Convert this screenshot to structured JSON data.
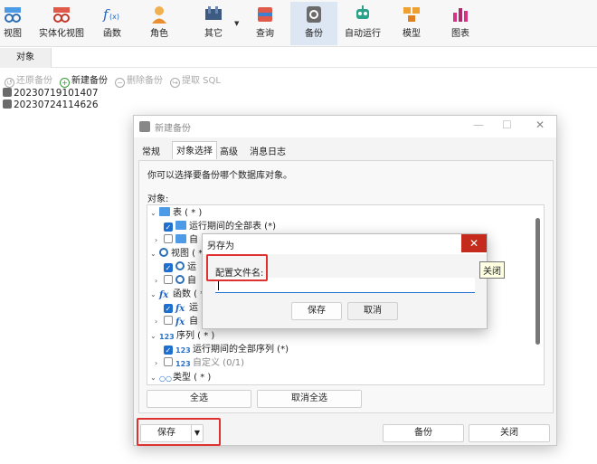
{
  "toolbar": {
    "items": [
      {
        "label": "视图",
        "icon": "view-icon"
      },
      {
        "label": "实体化视图",
        "icon": "materialized-view-icon"
      },
      {
        "label": "函数",
        "icon": "function-icon"
      },
      {
        "label": "角色",
        "icon": "role-icon"
      },
      {
        "label": "其它",
        "icon": "tools-icon"
      },
      {
        "label": "查询",
        "icon": "query-icon"
      },
      {
        "label": "备份",
        "icon": "backup-icon",
        "active": true
      },
      {
        "label": "自动运行",
        "icon": "robot-icon"
      },
      {
        "label": "模型",
        "icon": "model-icon"
      },
      {
        "label": "图表",
        "icon": "chart-icon"
      }
    ]
  },
  "tab": {
    "label": "对象"
  },
  "subtoolbar": {
    "restore": "还原备份",
    "new_backup": "新建备份",
    "delete": "删除备份",
    "extract_sql": "提取 SQL"
  },
  "backups": [
    "20230719101407",
    "20230724114626"
  ],
  "dialog": {
    "title": "新建备份",
    "tabs": [
      "常规",
      "对象选择",
      "高级",
      "消息日志"
    ],
    "intro": "你可以选择要备份哪个数据库对象。",
    "objects_label": "对象:",
    "tree": {
      "tables": "表 ( * )",
      "tables_all": "运行期间的全部表 (*)",
      "tables_custom": "自",
      "views": "视图 ( *",
      "views_all": "运",
      "views_custom": "自",
      "functions": "函数 ( *",
      "functions_all": "运",
      "functions_custom": "自",
      "sequences": "序列 ( * )",
      "sequences_all": "运行期间的全部序列 (*)",
      "sequences_custom": "自定义 (0/1)",
      "types": "类型 ( * )",
      "seq_icon_text": "123"
    },
    "select_all": "全选",
    "deselect_all": "取消全选",
    "save": "保存",
    "backup": "备份",
    "close": "关闭"
  },
  "save_dialog": {
    "title": "另存为",
    "field_label": "配置文件名:",
    "field_value": "",
    "save": "保存",
    "cancel": "取消",
    "close_glyph": "✕"
  },
  "tooltip": "关闭",
  "colors": {
    "accent": "#1f6fd1",
    "highlight": "#e03131",
    "close_red": "#c42b1c"
  }
}
